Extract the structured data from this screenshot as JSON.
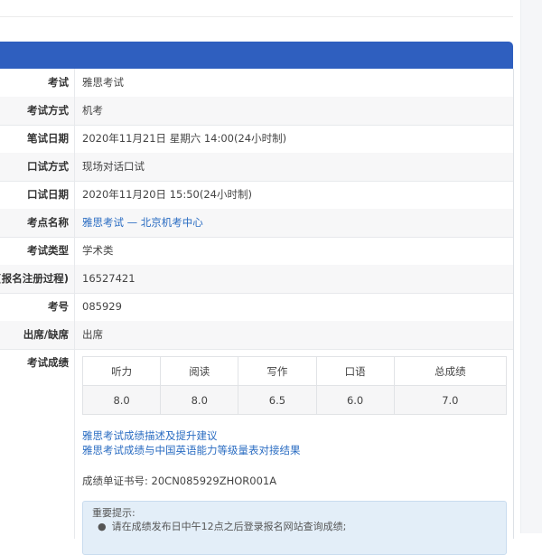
{
  "rows": [
    {
      "label": "考试",
      "value": "雅思考试"
    },
    {
      "label": "考试方式",
      "value": "机考"
    },
    {
      "label": "笔试日期",
      "value": "2020年11月21日 星期六 14:00(24小时制)"
    },
    {
      "label": "口试方式",
      "value": "现场对话口试"
    },
    {
      "label": "口试日期",
      "value": "2020年11月20日 15:50(24小时制)"
    },
    {
      "label": "考点名称",
      "value": "雅思考试 — 北京机考中心"
    },
    {
      "label": "考试类型",
      "value": "学术类"
    },
    {
      "label": "(报名注册过程)",
      "value": "16527421"
    },
    {
      "label": "考号",
      "value": "085929"
    },
    {
      "label": "出席/缺席",
      "value": "出席"
    }
  ],
  "scores": {
    "label": "考试成绩",
    "headers": [
      "听力",
      "阅读",
      "写作",
      "口语",
      "总成绩"
    ],
    "values": [
      "8.0",
      "8.0",
      "6.5",
      "6.0",
      "7.0"
    ]
  },
  "links": [
    "雅思考试成绩描述及提升建议",
    "雅思考试成绩与中国英语能力等级量表对接结果"
  ],
  "certificate": "成绩单证书号: 20CN085929ZHOR001A",
  "notice": {
    "title": "重要提示:",
    "item": "请在成绩发布日中午12点之后登录报名网站查询成绩;"
  },
  "colors": {
    "header_blue": "#2f5fbf",
    "link_blue": "#2a6cc2"
  }
}
